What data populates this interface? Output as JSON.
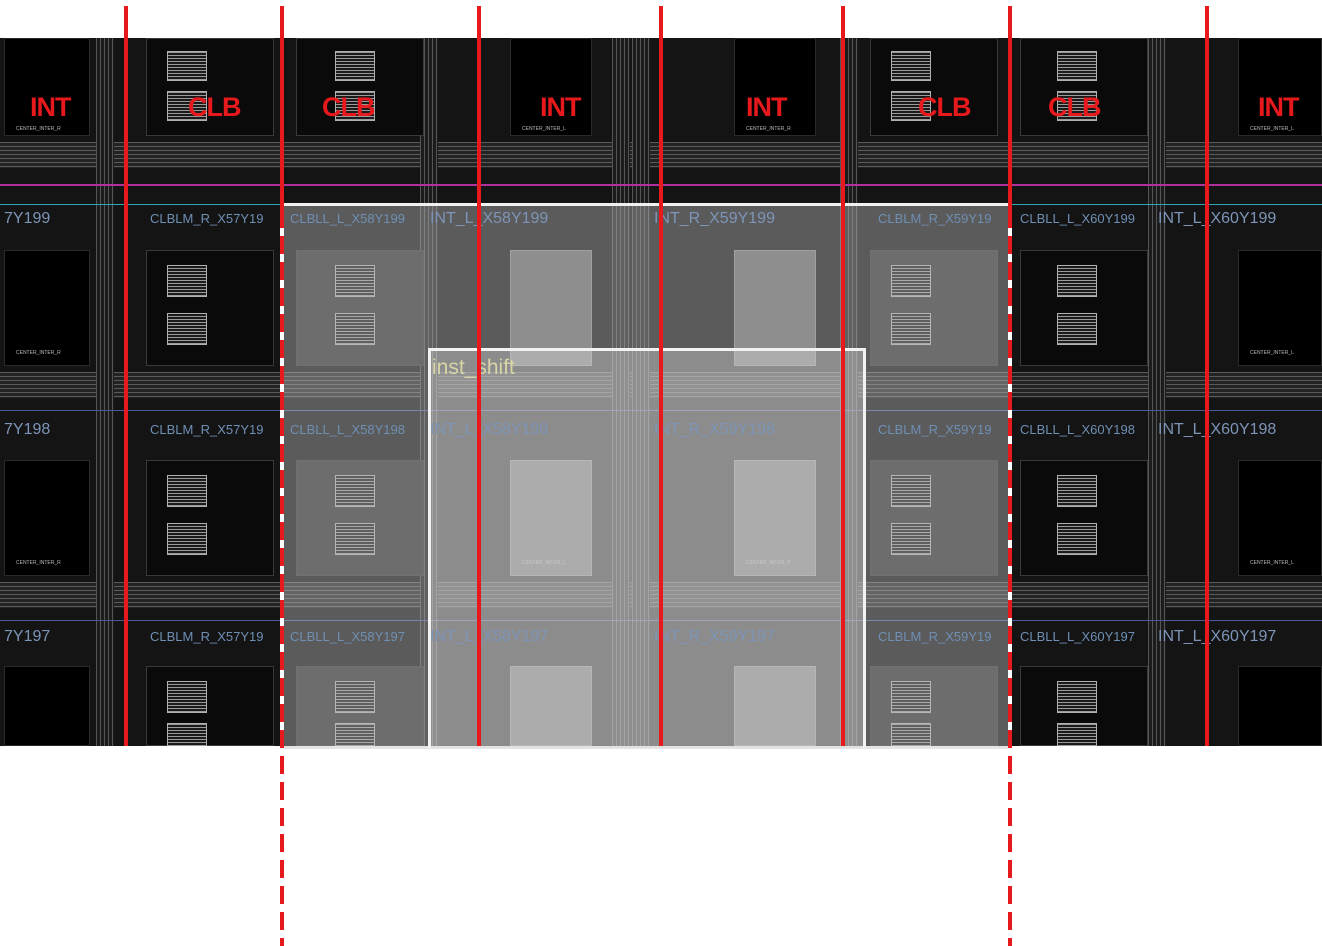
{
  "column_labels": {
    "int_1": "INT",
    "clb_1": "CLB",
    "clb_2": "CLB",
    "int_2": "INT",
    "int_3": "INT",
    "clb_3": "CLB",
    "clb_4": "CLB",
    "int_4": "INT"
  },
  "tile_tags": {
    "center_inter_r": "CENTER_INTER_R",
    "center_inter_l": "CENTER_INTER_L"
  },
  "rows": {
    "y199": {
      "left_edge": "7Y199",
      "clblm_r_x57": "CLBLM_R_X57Y19",
      "clbll_l_x58": "CLBLL_L_X58Y199",
      "int_l_x58": "INT_L_X58Y199",
      "int_r_x59": "INT_R_X59Y199",
      "clblm_r_x59": "CLBLM_R_X59Y19",
      "clbll_l_x60": "CLBLL_L_X60Y199",
      "int_l_x60": "INT_L_X60Y199"
    },
    "y198": {
      "left_edge": "7Y198",
      "clblm_r_x57": "CLBLM_R_X57Y19",
      "clbll_l_x58": "CLBLL_L_X58Y198",
      "int_l_x58": "INT_L_X58Y198",
      "int_r_x59": "INT_R_X59Y198",
      "clblm_r_x59": "CLBLM_R_X59Y19",
      "clbll_l_x60": "CLBLL_L_X60Y198",
      "int_l_x60": "INT_L_X60Y198"
    },
    "y197": {
      "left_edge": "7Y197",
      "clblm_r_x57": "CLBLM_R_X57Y19",
      "clbll_l_x58": "CLBLL_L_X58Y197",
      "int_l_x58": "INT_L_X58Y197",
      "int_r_x59": "INT_R_X59Y197",
      "clblm_r_x59": "CLBLM_R_X59Y19",
      "clbll_l_x60": "CLBLL_L_X60Y197",
      "int_l_x60": "INT_L_X60Y197"
    }
  },
  "instance_label": "inst_shift",
  "colors": {
    "annotation_red": "#e8191c",
    "row_label_blue": "#6f8fb4",
    "instance_label": "#d8d4a6",
    "clock_line_magenta": "#b0309c",
    "cyan_line": "#2fa6b6",
    "pblock_border": "#f0f0f0"
  }
}
